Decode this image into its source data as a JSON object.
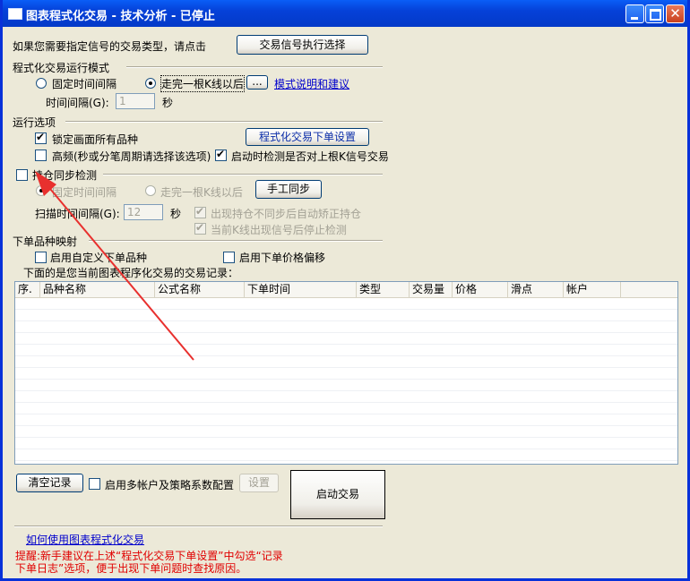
{
  "window": {
    "title": "图表程式化交易 - 技术分析 - 已停止",
    "minimize": "",
    "maximize": "",
    "close": "✕"
  },
  "signal": {
    "prompt": "如果您需要指定信号的交易类型，请点击",
    "button": "交易信号执行选择"
  },
  "run_mode": {
    "heading": "程式化交易运行模式",
    "fixed_interval": "固定时间间隔",
    "after_bar": "走完一根K线以后",
    "more_button": "...",
    "help_link": "模式说明和建议",
    "interval_label": "时间间隔(G):",
    "interval_value": "1",
    "interval_unit": "秒"
  },
  "run_options": {
    "heading": "运行选项",
    "lock_all": "锁定画面所有品种",
    "order_settings_button": "程式化交易下单设置",
    "high_freq": "高频(秒或分笔周期请选择该选项)",
    "check_on_start": "启动时检测是否对上根K信号交易"
  },
  "sync": {
    "heading": "持仓同步检测",
    "fixed_interval": "固定时间间隔",
    "after_bar": "走完一根K线以后",
    "manual_button": "手工同步",
    "scan_label": "扫描时间间隔(G):",
    "scan_value": "12",
    "scan_unit": "秒",
    "auto_correct": "出现持仓不同步后自动矫正持仓",
    "stop_detect": "当前K线出现信号后停止检测"
  },
  "mapping": {
    "heading": "下单品种映射",
    "custom_symbol": "启用自定义下单品种",
    "price_offset": "启用下单价格偏移"
  },
  "records": {
    "caption": "下面的是您当前图表程序化交易的交易记录：",
    "columns": [
      "序.",
      "品种名称",
      "公式名称",
      "下单时间",
      "类型",
      "交易量",
      "价格",
      "滑点",
      "帐户"
    ]
  },
  "bottom": {
    "clear_button": "清空记录",
    "multi_account": "启用多帐户及策略系数配置",
    "settings_button": "设置",
    "start_button": "启动交易",
    "howto_link": "如何使用图表程式化交易",
    "tip_line1": "提醒:新手建议在上述“程式化交易下单设置”中勾选“记录",
    "tip_line2": "下单日志”选项，便于出现下单问题时查找原因。"
  },
  "colors": {
    "title_bar": "#0541d8",
    "arrow": "#e8302e",
    "tip_text": "#e00000",
    "link": "#0000cc"
  }
}
